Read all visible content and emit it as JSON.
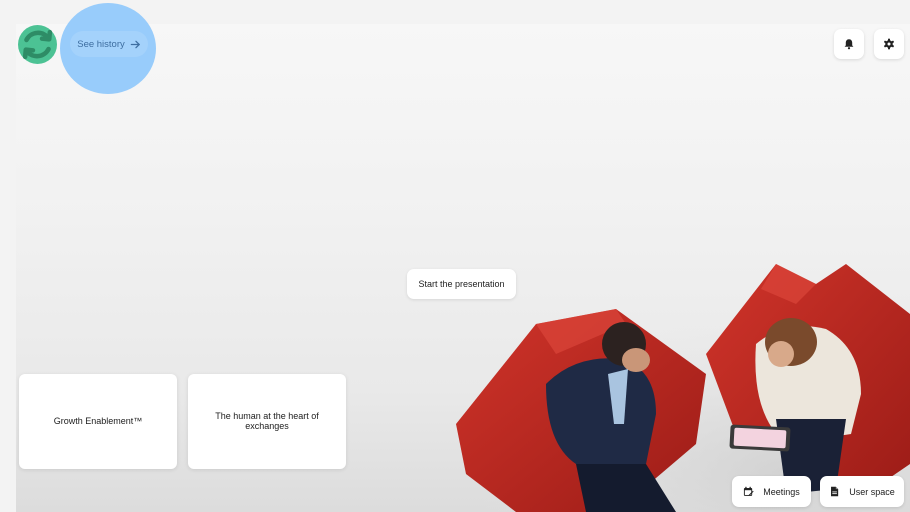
{
  "top_bar": {
    "history_label": "See history"
  },
  "main": {
    "present_label": "Start the presentation",
    "cards": [
      {
        "label": "Growth Enablement™"
      },
      {
        "label": "The human at the heart of exchanges"
      }
    ]
  },
  "bottom_bar": {
    "meetings_label": "Meetings",
    "user_space_label": "User space"
  },
  "icons": {
    "refresh": "refresh-icon",
    "arrow": "arrow-right-icon",
    "bell": "bell-icon",
    "gear": "gear-icon",
    "calendar": "calendar-icon",
    "document": "document-icon"
  },
  "colors": {
    "refresh_button": "#4cc294",
    "history_highlight": "#87c4fc",
    "chair_red": "#c12b23"
  }
}
